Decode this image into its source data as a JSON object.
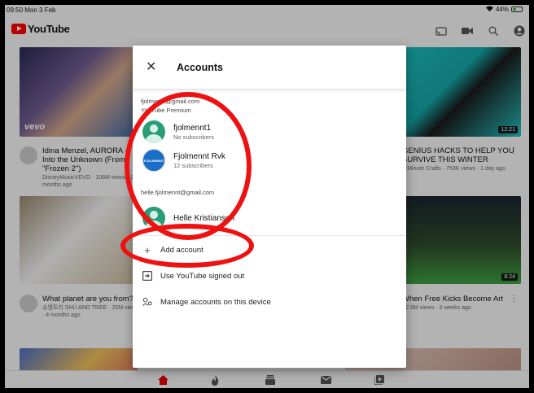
{
  "status_bar": {
    "time": "09:50",
    "date": "Mon 3 Feb",
    "battery": "44%",
    "battery_level": 0.44
  },
  "header": {
    "logo_text": "YouTube",
    "icons": [
      "cast-icon",
      "camera-icon",
      "search-icon",
      "account-icon"
    ]
  },
  "videos": [
    {
      "title": "Idina Menzel, AURORA - Into the Unknown (From \"Frozen 2\")",
      "sub": "DisneyMusicVEVO · 106M views · 2 months ago",
      "badge": "vevo"
    },
    {
      "title": "GENIUS HACKS TO HELP YOU SURVIVE THIS WINTER",
      "sub": "5-Minute Crafts · 753K views · 1 day ago",
      "duration": "12:21"
    },
    {
      "title": "What planet are you from?",
      "sub": "슈앤트리 SHU AND TREE · 25M views · 4 months ago"
    },
    {
      "title": "When Free Kicks Become Art",
      "sub": "· 2.8M views · 3 weeks ago",
      "duration": "8:24"
    }
  ],
  "tabs": [
    "home-icon",
    "trending-icon",
    "subscriptions-icon",
    "inbox-icon",
    "library-icon"
  ],
  "dialog": {
    "title": "Accounts",
    "account_email_1": "fjolmennt@gmail.com",
    "account_tier_1": "YouTube Premium",
    "accounts_1": [
      {
        "name": "fjolmennt1",
        "sub": "No subscribers"
      },
      {
        "name": "Fjolmennt Rvk",
        "sub": "12 subscribers"
      }
    ],
    "account_email_2": "helle.fjolmennt@gmail.com",
    "accounts_2": [
      {
        "name": "Helle Kristiansen"
      }
    ],
    "brand_avatar_text": "FJOLMENNT",
    "menu": {
      "add_account": "Add account",
      "use_signed_out": "Use YouTube signed out",
      "manage_accounts": "Manage accounts on this device"
    }
  },
  "colors": {
    "annotation": "#ee1111",
    "brand_red": "#ff0000",
    "avatar_green": "#2a9d78"
  }
}
